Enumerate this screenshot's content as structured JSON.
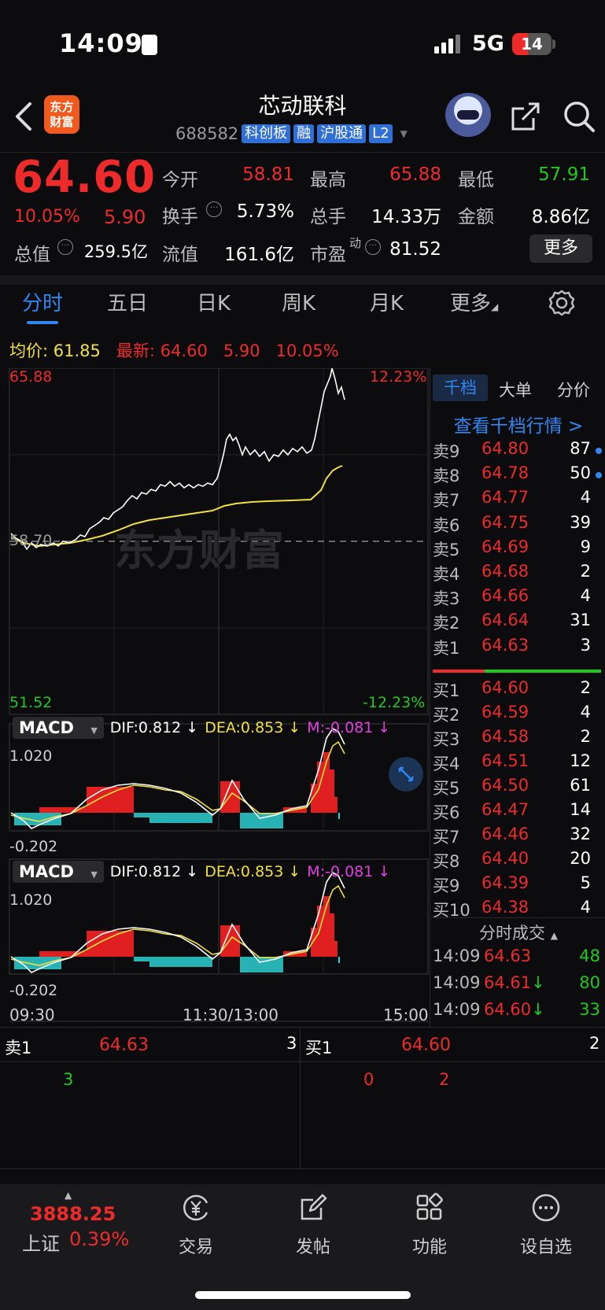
{
  "status_bar": {
    "time": "14:09",
    "network": "5G",
    "battery": "14"
  },
  "header": {
    "logo_text": "东方财富",
    "stock_name": "芯动联科",
    "code": "688582",
    "tags": [
      "科创板",
      "融",
      "沪股通",
      "L2"
    ]
  },
  "quote": {
    "price": "64.60",
    "change_pct": "10.05%",
    "change": "5.90",
    "open_label": "今开",
    "open": "58.81",
    "high_label": "最高",
    "high": "65.88",
    "low_label": "最低",
    "low": "57.91",
    "turnover_label": "换手",
    "turnover": "5.73%",
    "volume_label": "总手",
    "volume": "14.33万",
    "amount_label": "金额",
    "amount": "8.86亿",
    "mcap_label": "总值",
    "mcap": "259.5亿",
    "float_label": "流值",
    "float_mcap": "161.6亿",
    "pe_label": "市盈",
    "pe_sup": "动",
    "pe": "81.52",
    "more": "更多"
  },
  "tabs": [
    "分时",
    "五日",
    "日K",
    "周K",
    "月K",
    "更多"
  ],
  "avg_row": {
    "avg_label": "均价:",
    "avg": "61.85",
    "latest_label": "最新:",
    "latest": "64.60",
    "latest_chg": "5.90",
    "latest_pct": "10.05%"
  },
  "chart": {
    "top_price": "65.88",
    "top_pct": "12.23%",
    "bottom_price": "51.52",
    "bottom_pct": "-12.23%",
    "ref_price": "58.70",
    "watermark": "东方财富",
    "x_labels": [
      "09:30",
      "11:30/13:00",
      "15:00"
    ]
  },
  "macd": {
    "name": "MACD",
    "dif": "DIF:0.812 ↓",
    "dea": "DEA:0.853 ↓",
    "m": "M:-0.081 ↓",
    "top": "1.020",
    "bottom": "-0.202"
  },
  "order_book": {
    "tabs": [
      "千档",
      "大单",
      "分价"
    ],
    "view_link": "查看千档行情 >",
    "asks": [
      {
        "label": "卖9",
        "price": "64.80",
        "vol": "87"
      },
      {
        "label": "卖8",
        "price": "64.78",
        "vol": "50"
      },
      {
        "label": "卖7",
        "price": "64.77",
        "vol": "4"
      },
      {
        "label": "卖6",
        "price": "64.75",
        "vol": "39"
      },
      {
        "label": "卖5",
        "price": "64.69",
        "vol": "9"
      },
      {
        "label": "卖4",
        "price": "64.68",
        "vol": "2"
      },
      {
        "label": "卖3",
        "price": "64.66",
        "vol": "4"
      },
      {
        "label": "卖2",
        "price": "64.64",
        "vol": "31"
      },
      {
        "label": "卖1",
        "price": "64.63",
        "vol": "3"
      }
    ],
    "bids": [
      {
        "label": "买1",
        "price": "64.60",
        "vol": "2"
      },
      {
        "label": "买2",
        "price": "64.59",
        "vol": "4"
      },
      {
        "label": "买3",
        "price": "64.58",
        "vol": "2"
      },
      {
        "label": "买4",
        "price": "64.51",
        "vol": "12"
      },
      {
        "label": "买5",
        "price": "64.50",
        "vol": "61"
      },
      {
        "label": "买6",
        "price": "64.47",
        "vol": "14"
      },
      {
        "label": "买7",
        "price": "64.46",
        "vol": "32"
      },
      {
        "label": "买8",
        "price": "64.40",
        "vol": "20"
      },
      {
        "label": "买9",
        "price": "64.39",
        "vol": "5"
      },
      {
        "label": "买10",
        "price": "64.38",
        "vol": "4"
      }
    ],
    "ticks_header": "分时成交",
    "ticks": [
      {
        "time": "14:09",
        "price": "64.63",
        "arrow": "",
        "vol": "48"
      },
      {
        "time": "14:09",
        "price": "64.61",
        "arrow": "↓",
        "vol": "80"
      },
      {
        "time": "14:09",
        "price": "64.60",
        "arrow": "↓",
        "vol": "33"
      }
    ]
  },
  "strip": {
    "ask_label": "卖1",
    "ask_price": "64.63",
    "ask_vol": "3",
    "ask_sub": "3",
    "bid_label": "买1",
    "bid_price": "64.60",
    "bid_vol": "2",
    "bid_sub1": "0",
    "bid_sub2": "2"
  },
  "bottom_nav": {
    "index_value": "3888.25",
    "index_name": "上证",
    "index_pct": "0.39%",
    "items": [
      "交易",
      "发帖",
      "功能",
      "设自选"
    ]
  },
  "colors": {
    "up": "#ee2b2b",
    "down": "#1ec81e",
    "accent": "#2f86f0",
    "avg_line": "#f0e040"
  }
}
